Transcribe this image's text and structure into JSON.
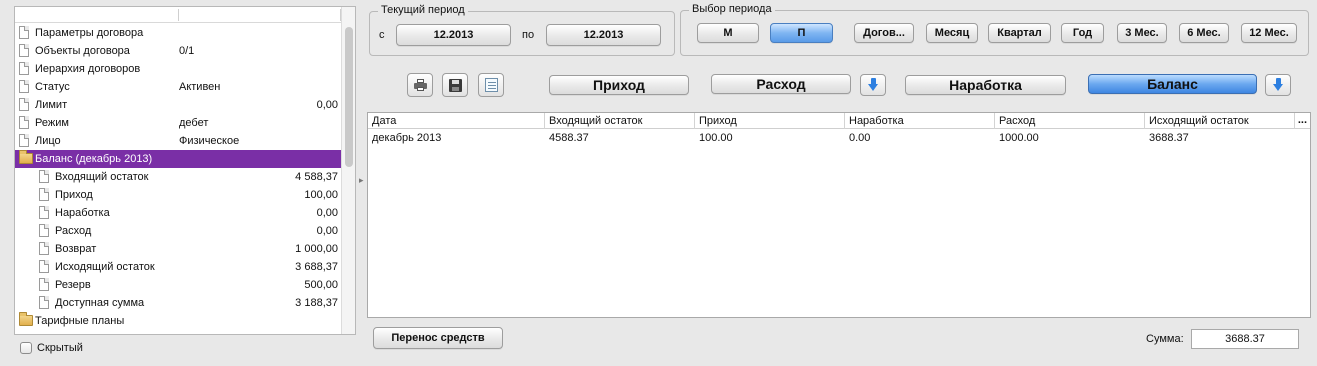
{
  "tree": {
    "rows": [
      {
        "label": "Параметры договора",
        "value": "",
        "num": "",
        "icon": "document-icon",
        "indent": 0
      },
      {
        "label": "Объекты договора",
        "value": "0/1",
        "num": "",
        "icon": "document-icon",
        "indent": 0
      },
      {
        "label": "Иерархия договоров",
        "value": "",
        "num": "",
        "icon": "document-icon",
        "indent": 0
      },
      {
        "label": "Статус",
        "value": "Активен",
        "num": "",
        "icon": "document-icon",
        "indent": 0
      },
      {
        "label": "Лимит",
        "value": "",
        "num": "0,00",
        "icon": "document-icon",
        "indent": 0
      },
      {
        "label": "Режим",
        "value": "дебет",
        "num": "",
        "icon": "document-icon",
        "indent": 0
      },
      {
        "label": "Лицо",
        "value": "Физическое",
        "num": "",
        "icon": "document-icon",
        "indent": 0
      },
      {
        "label": "Баланс (декабрь 2013)",
        "value": "",
        "num": "",
        "icon": "folder-open-icon",
        "indent": 0,
        "selected": true
      },
      {
        "label": "Входящий остаток",
        "value": "",
        "num": "4 588,37",
        "icon": "document-icon",
        "indent": 1
      },
      {
        "label": "Приход",
        "value": "",
        "num": "100,00",
        "icon": "document-icon",
        "indent": 1
      },
      {
        "label": "Наработка",
        "value": "",
        "num": "0,00",
        "icon": "document-icon",
        "indent": 1
      },
      {
        "label": "Расход",
        "value": "",
        "num": "0,00",
        "icon": "document-icon",
        "indent": 1
      },
      {
        "label": "Возврат",
        "value": "",
        "num": "1 000,00",
        "icon": "document-icon",
        "indent": 1
      },
      {
        "label": "Исходящий остаток",
        "value": "",
        "num": "3 688,37",
        "icon": "document-icon",
        "indent": 1
      },
      {
        "label": "Резерв",
        "value": "",
        "num": "500,00",
        "icon": "document-icon",
        "indent": 1
      },
      {
        "label": "Доступная сумма",
        "value": "",
        "num": "3 188,37",
        "icon": "document-icon",
        "indent": 1
      },
      {
        "label": "Тарифные планы",
        "value": "",
        "num": "",
        "icon": "folder-icon",
        "indent": 0
      }
    ],
    "selected_color": "#7a2fa6"
  },
  "hidden_checkbox": {
    "label": "Скрытый",
    "checked": false
  },
  "current_period": {
    "title": "Текущий период",
    "from_label": "с",
    "from_value": "12.2013",
    "to_label": "по",
    "to_value": "12.2013"
  },
  "period_select": {
    "title": "Выбор периода",
    "buttons": [
      {
        "label": "М",
        "active": false
      },
      {
        "label": "П",
        "active": true
      },
      {
        "label": "Догов...",
        "active": false
      },
      {
        "label": "Месяц",
        "active": false
      },
      {
        "label": "Квартал",
        "active": false
      },
      {
        "label": "Год",
        "active": false
      },
      {
        "label": "3 Мес.",
        "active": false
      },
      {
        "label": "6 Мес.",
        "active": false
      },
      {
        "label": "12 Мес.",
        "active": false
      }
    ]
  },
  "toolbar": {
    "icons": [
      "printer-icon",
      "save-icon",
      "print-preview-icon"
    ],
    "view_buttons": [
      {
        "label": "Приход",
        "active": false
      },
      {
        "label": "Расход",
        "active": false
      },
      {
        "label": "Наработка",
        "active": false
      },
      {
        "label": "Баланс",
        "active": true
      }
    ],
    "accent_color": "#3f86e2"
  },
  "table": {
    "columns": [
      "Дата",
      "Входящий остаток",
      "Приход",
      "Наработка",
      "Расход",
      "Исходящий остаток"
    ],
    "column_menu": "...",
    "rows": [
      [
        "декабрь 2013",
        "4588.37",
        "100.00",
        "0.00",
        "1000.00",
        "3688.37"
      ]
    ]
  },
  "footer": {
    "transfer_button": "Перенос средств",
    "sum_label": "Сумма:",
    "sum_value": "3688.37"
  }
}
